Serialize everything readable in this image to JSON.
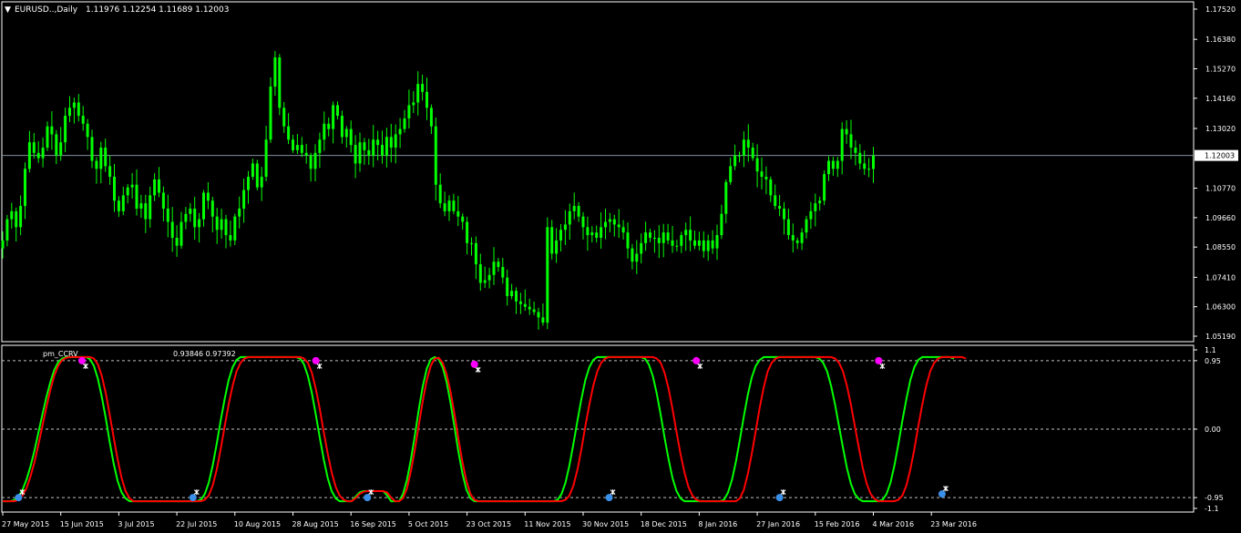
{
  "colors": {
    "background": "#000000",
    "frame": "#ffffff",
    "candle": "#00ff00",
    "price_line": "#7f8fa0",
    "main_line": "#00ff00",
    "signal_line": "#ff0000",
    "buy_dot": "#3a8fe8",
    "sell_dot": "#ff00ff",
    "cross_mark": "#ffffff",
    "level_line": "#c0c0c0"
  },
  "header": {
    "arrow": "▼",
    "title": "EURUSD..,Daily",
    "ohlc": "1.11976 1.12254 1.11689 1.12003"
  },
  "indicator": {
    "name": "pm_CCRV",
    "values": "0.93846 0.97392"
  },
  "chart_data": [
    {
      "type": "candlestick",
      "title": "EURUSD..,Daily",
      "ylim": [
        1.0519,
        1.1752
      ],
      "y_ticks": [
        "1.17520",
        "1.16380",
        "1.15270",
        "1.14160",
        "1.13020",
        "1.10770",
        "1.09660",
        "1.08550",
        "1.07410",
        "1.06300",
        "1.05190"
      ],
      "current_price": "1.12003",
      "x_ticks": [
        "27 May 2015",
        "15 Jun 2015",
        "3 Jul 2015",
        "22 Jul 2015",
        "10 Aug 2015",
        "28 Aug 2015",
        "16 Sep 2015",
        "5 Oct 2015",
        "23 Oct 2015",
        "11 Nov 2015",
        "30 Nov 2015",
        "18 Dec 2015",
        "8 Jan 2016",
        "27 Jan 2016",
        "15 Feb 2016",
        "4 Mar 2016",
        "23 Mar 2016"
      ],
      "x_tick_bar_index": [
        0,
        13,
        26,
        39,
        52,
        65,
        78,
        91,
        104,
        117,
        130,
        143,
        156,
        169,
        182,
        195,
        208
      ],
      "closes": [
        1.088,
        1.096,
        1.099,
        1.093,
        1.101,
        1.115,
        1.125,
        1.121,
        1.119,
        1.123,
        1.131,
        1.128,
        1.12,
        1.125,
        1.135,
        1.138,
        1.14,
        1.135,
        1.132,
        1.127,
        1.118,
        1.115,
        1.123,
        1.116,
        1.112,
        1.103,
        1.099,
        1.105,
        1.108,
        1.109,
        1.1,
        1.102,
        1.096,
        1.105,
        1.111,
        1.106,
        1.1,
        1.095,
        1.089,
        1.086,
        1.095,
        1.098,
        1.1,
        1.093,
        1.096,
        1.106,
        1.103,
        1.097,
        1.092,
        1.096,
        1.09,
        1.088,
        1.097,
        1.1,
        1.107,
        1.112,
        1.117,
        1.108,
        1.112,
        1.126,
        1.146,
        1.157,
        1.138,
        1.131,
        1.126,
        1.122,
        1.124,
        1.121,
        1.12,
        1.115,
        1.121,
        1.126,
        1.132,
        1.13,
        1.139,
        1.135,
        1.127,
        1.13,
        1.124,
        1.117,
        1.125,
        1.122,
        1.12,
        1.126,
        1.124,
        1.12,
        1.127,
        1.123,
        1.128,
        1.13,
        1.134,
        1.139,
        1.14,
        1.147,
        1.144,
        1.138,
        1.131,
        1.109,
        1.102,
        1.099,
        1.103,
        1.099,
        1.097,
        1.095,
        1.087,
        1.087,
        1.079,
        1.072,
        1.073,
        1.075,
        1.08,
        1.078,
        1.074,
        1.067,
        1.069,
        1.065,
        1.064,
        1.063,
        1.062,
        1.061,
        1.059,
        1.057,
        1.093,
        1.083,
        1.088,
        1.092,
        1.094,
        1.099,
        1.101,
        1.097,
        1.093,
        1.09,
        1.091,
        1.089,
        1.093,
        1.095,
        1.096,
        1.094,
        1.093,
        1.091,
        1.085,
        1.08,
        1.083,
        1.087,
        1.091,
        1.089,
        1.089,
        1.087,
        1.091,
        1.088,
        1.086,
        1.086,
        1.09,
        1.092,
        1.088,
        1.086,
        1.088,
        1.084,
        1.088,
        1.085,
        1.09,
        1.098,
        1.11,
        1.116,
        1.12,
        1.12,
        1.126,
        1.123,
        1.119,
        1.114,
        1.112,
        1.111,
        1.105,
        1.101,
        1.1,
        1.096,
        1.09,
        1.088,
        1.087,
        1.091,
        1.096,
        1.099,
        1.102,
        1.103,
        1.113,
        1.118,
        1.115,
        1.118,
        1.13,
        1.128,
        1.123,
        1.121,
        1.117,
        1.115,
        1.115,
        1.12
      ]
    },
    {
      "type": "line",
      "title": "pm_CCRV",
      "ylim": [
        -1.1,
        1.1
      ],
      "y_ticks": [
        "1.1",
        "0.95",
        "0.00",
        "-0.95",
        "-1.1"
      ],
      "levels": [
        0.95,
        0.0,
        -0.95
      ],
      "series": [
        {
          "values": [
            -1.0,
            -1.0,
            -1.0,
            -0.98,
            -0.93,
            -0.84,
            -0.7,
            -0.52,
            -0.3,
            -0.05,
            0.2,
            0.44,
            0.65,
            0.82,
            0.93,
            0.98,
            1.0,
            1.0,
            1.0,
            1.0,
            1.0,
            1.0,
            0.97,
            0.88,
            0.7,
            0.45,
            0.15,
            -0.18,
            -0.48,
            -0.72,
            -0.88,
            -0.96,
            -1.0,
            -1.0,
            -1.0,
            -1.0,
            -1.0,
            -1.0,
            -1.0,
            -1.0,
            -1.0,
            -1.0,
            -1.0,
            -1.0,
            -1.0,
            -1.0,
            -1.0,
            -1.0,
            -1.0,
            -1.0,
            -0.98,
            -0.9,
            -0.74,
            -0.5,
            -0.2,
            0.12,
            0.42,
            0.68,
            0.86,
            0.96,
            1.0,
            1.0,
            1.0,
            1.0,
            1.0,
            1.0,
            1.0,
            1.0,
            1.0,
            1.0,
            1.0,
            1.0,
            1.0,
            1.0,
            1.0,
            0.98,
            0.9,
            0.74,
            0.5,
            0.2,
            -0.12,
            -0.42,
            -0.68,
            -0.86,
            -0.96,
            -1.0,
            -1.0,
            -1.0,
            -1.0,
            -0.94,
            -0.88,
            -0.86,
            -0.86,
            -0.86,
            -0.86,
            -0.86,
            -0.86,
            -0.92,
            -1.0,
            -1.0,
            -1.0,
            -0.9,
            -0.7,
            -0.42,
            -0.08,
            0.28,
            0.6,
            0.84,
            0.97,
            1.0,
            0.97,
            0.86,
            0.65,
            0.36,
            0.02,
            -0.32,
            -0.62,
            -0.84,
            -0.96,
            -1.0,
            -1.0,
            -1.0,
            -1.0,
            -1.0,
            -1.0,
            -1.0,
            -1.0,
            -1.0,
            -1.0,
            -1.0,
            -1.0,
            -1.0,
            -1.0,
            -1.0,
            -1.0,
            -1.0,
            -1.0,
            -1.0,
            -1.0,
            -1.0,
            -0.98,
            -0.9,
            -0.74,
            -0.5,
            -0.2,
            0.12,
            0.42,
            0.68,
            0.86,
            0.96,
            1.0,
            1.0,
            1.0,
            1.0,
            1.0,
            1.0,
            1.0,
            1.0,
            1.0,
            1.0,
            1.0,
            1.0,
            0.98,
            0.9,
            0.74,
            0.5,
            0.2,
            -0.12,
            -0.42,
            -0.68,
            -0.86,
            -0.96,
            -1.0,
            -1.0,
            -1.0,
            -1.0,
            -1.0,
            -1.0,
            -1.0,
            -1.0,
            -1.0,
            -1.0,
            -0.98,
            -0.88,
            -0.7,
            -0.45,
            -0.14,
            0.18,
            0.48,
            0.72,
            0.88,
            0.96,
            1.0,
            1.0,
            1.0,
            1.0,
            1.0,
            1.0,
            1.0,
            1.0,
            1.0,
            1.0,
            1.0,
            1.0,
            1.0,
            1.0,
            0.98,
            0.92,
            0.8,
            0.6,
            0.34,
            0.04,
            -0.26,
            -0.54,
            -0.76,
            -0.9,
            -0.97,
            -1.0,
            -1.0,
            -1.0,
            -1.0,
            -1.0,
            -0.98,
            -0.9,
            -0.74,
            -0.5,
            -0.2,
            0.12,
            0.42,
            0.68,
            0.86,
            0.96,
            1.0,
            1.0,
            1.0,
            1.0,
            1.0,
            1.0,
            1.0,
            1.0,
            0.98
          ]
        },
        {
          "values": [
            -1.0,
            -1.0,
            -1.0,
            -1.0,
            -0.98,
            -0.92,
            -0.82,
            -0.66,
            -0.46,
            -0.22,
            0.04,
            0.3,
            0.54,
            0.74,
            0.88,
            0.96,
            0.99,
            1.0,
            1.0,
            1.0,
            1.0,
            1.0,
            1.0,
            0.98,
            0.9,
            0.74,
            0.5,
            0.2,
            -0.12,
            -0.42,
            -0.68,
            -0.86,
            -0.96,
            -1.0,
            -1.0,
            -1.0,
            -1.0,
            -1.0,
            -1.0,
            -1.0,
            -1.0,
            -1.0,
            -1.0,
            -1.0,
            -1.0,
            -1.0,
            -1.0,
            -1.0,
            -1.0,
            -1.0,
            -1.0,
            -0.98,
            -0.92,
            -0.78,
            -0.56,
            -0.28,
            0.04,
            0.34,
            0.6,
            0.8,
            0.92,
            0.98,
            1.0,
            1.0,
            1.0,
            1.0,
            1.0,
            1.0,
            1.0,
            1.0,
            1.0,
            1.0,
            1.0,
            1.0,
            1.0,
            1.0,
            0.98,
            0.92,
            0.78,
            0.56,
            0.28,
            -0.04,
            -0.34,
            -0.6,
            -0.8,
            -0.92,
            -0.98,
            -1.0,
            -1.0,
            -0.96,
            -0.9,
            -0.87,
            -0.86,
            -0.86,
            -0.86,
            -0.86,
            -0.86,
            -0.88,
            -0.95,
            -1.0,
            -1.0,
            -0.96,
            -0.82,
            -0.58,
            -0.28,
            0.06,
            0.4,
            0.68,
            0.88,
            0.98,
            0.99,
            0.92,
            0.76,
            0.52,
            0.2,
            -0.14,
            -0.46,
            -0.72,
            -0.9,
            -0.98,
            -1.0,
            -1.0,
            -1.0,
            -1.0,
            -1.0,
            -1.0,
            -1.0,
            -1.0,
            -1.0,
            -1.0,
            -1.0,
            -1.0,
            -1.0,
            -1.0,
            -1.0,
            -1.0,
            -1.0,
            -1.0,
            -1.0,
            -1.0,
            -1.0,
            -1.0,
            -0.98,
            -0.92,
            -0.78,
            -0.56,
            -0.28,
            0.04,
            0.34,
            0.6,
            0.8,
            0.92,
            0.98,
            1.0,
            1.0,
            1.0,
            1.0,
            1.0,
            1.0,
            1.0,
            1.0,
            1.0,
            1.0,
            1.0,
            1.0,
            0.98,
            0.92,
            0.78,
            0.56,
            0.28,
            -0.04,
            -0.34,
            -0.6,
            -0.8,
            -0.92,
            -0.98,
            -1.0,
            -1.0,
            -1.0,
            -1.0,
            -1.0,
            -1.0,
            -1.0,
            -1.0,
            -1.0,
            -1.0,
            -0.96,
            -0.84,
            -0.62,
            -0.34,
            -0.02,
            0.3,
            0.58,
            0.8,
            0.92,
            0.98,
            1.0,
            1.0,
            1.0,
            1.0,
            1.0,
            1.0,
            1.0,
            1.0,
            1.0,
            1.0,
            1.0,
            1.0,
            1.0,
            1.0,
            0.98,
            0.92,
            0.8,
            0.6,
            0.34,
            0.04,
            -0.26,
            -0.54,
            -0.76,
            -0.9,
            -0.97,
            -1.0,
            -1.0,
            -1.0,
            -1.0,
            -1.0,
            -0.98,
            -0.92,
            -0.78,
            -0.56,
            -0.28,
            0.04,
            0.34,
            0.6,
            0.8,
            0.92,
            0.98,
            1.0,
            1.0,
            1.0,
            1.0,
            1.0,
            1.0,
            0.98
          ]
        }
      ],
      "markers": [
        {
          "kind": "buy",
          "x": 4,
          "y": -0.95
        },
        {
          "kind": "sell",
          "x": 20,
          "y": 0.95
        },
        {
          "kind": "buy",
          "x": 48,
          "y": -0.95
        },
        {
          "kind": "sell",
          "x": 79,
          "y": 0.95
        },
        {
          "kind": "buy",
          "x": 92,
          "y": -0.95
        },
        {
          "kind": "sell",
          "x": 119,
          "y": 0.9
        },
        {
          "kind": "buy",
          "x": 153,
          "y": -0.95
        },
        {
          "kind": "sell",
          "x": 175,
          "y": 0.95
        },
        {
          "kind": "buy",
          "x": 196,
          "y": -0.95
        },
        {
          "kind": "sell",
          "x": 221,
          "y": 0.95
        },
        {
          "kind": "buy",
          "x": 237,
          "y": -0.9
        }
      ]
    }
  ]
}
